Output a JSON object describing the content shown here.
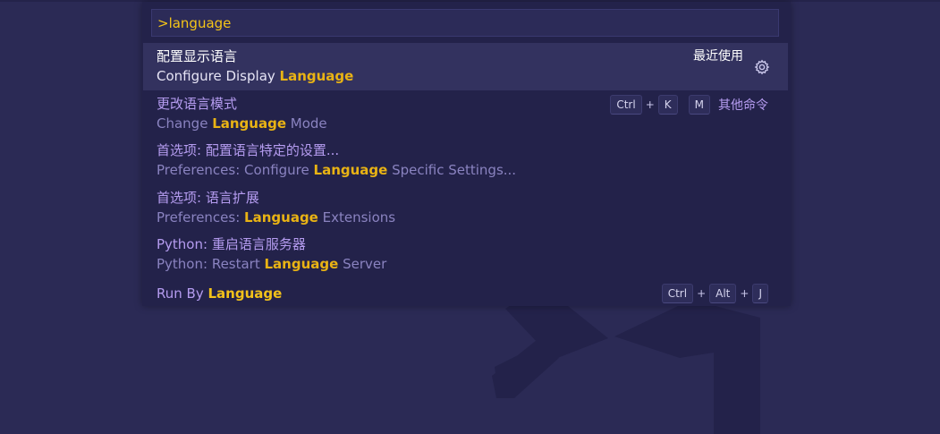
{
  "input": {
    "value": ">language",
    "placeholder": ""
  },
  "items": [
    {
      "label_zh": "配置显示语言",
      "detail_pre": "Configure Display ",
      "detail_hl": "Language",
      "detail_post": "",
      "recent_label": "最近使用"
    },
    {
      "label_zh": "更改语言模式",
      "detail_pre": "Change ",
      "detail_hl": "Language",
      "detail_post": " Mode",
      "keys": [
        "Ctrl",
        "+",
        "K",
        "M"
      ],
      "other_label": "其他命令"
    },
    {
      "label_zh": "首选项: 配置语言特定的设置...",
      "detail_pre": "Preferences: Configure ",
      "detail_hl": "Language",
      "detail_post": " Specific Settings..."
    },
    {
      "label_zh": "首选项: 语言扩展",
      "detail_pre": "Preferences: ",
      "detail_hl": "Language",
      "detail_post": " Extensions"
    },
    {
      "label_zh": "Python: 重启语言服务器",
      "detail_pre": "Python: Restart ",
      "detail_hl": "Language",
      "detail_post": " Server"
    },
    {
      "label_pre": "Run By ",
      "label_hl": "Language",
      "keys": [
        "Ctrl",
        "+",
        "Alt",
        "+",
        "J"
      ]
    }
  ],
  "colors": {
    "background": "#2b2a55",
    "panel": "#23224a",
    "selected_row": "#33325f",
    "highlight": "#e9b314",
    "command_label": "#b59cf0",
    "input_text": "#f5c518"
  },
  "icons": {
    "gear": "gear-icon",
    "watermark": "vscode-logo-watermark"
  }
}
